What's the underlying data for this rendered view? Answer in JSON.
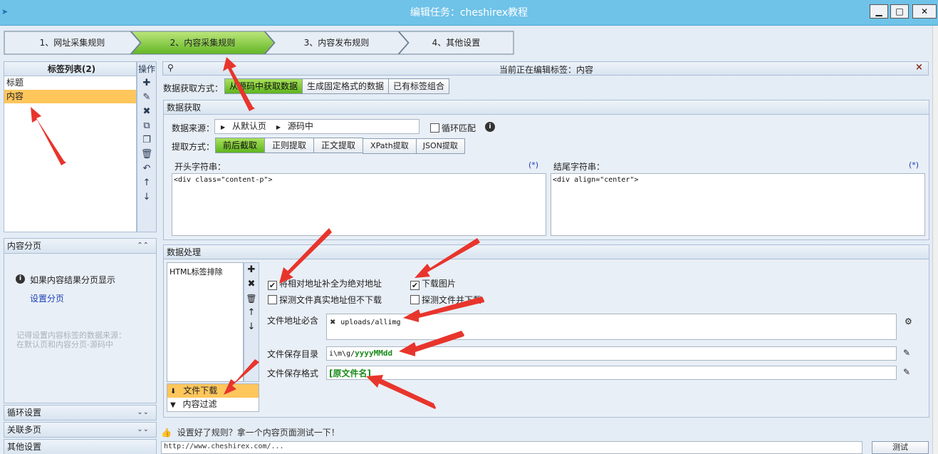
{
  "window": {
    "title": "编辑任务：cheshirex教程",
    "min": "▁",
    "max": "□",
    "close": "✕"
  },
  "steps": [
    "1、网址采集规则",
    "2、内容采集规则",
    "3、内容发布规则",
    "4、其他设置"
  ],
  "tag_list": {
    "title": "标签列表(2)",
    "items": [
      "标题",
      "内容"
    ],
    "ops_label": "操作"
  },
  "side": {
    "pagination_title": "内容分页",
    "pagination_info": "如果内容结果分页显示",
    "pagination_link": "设置分页",
    "note_line1": "记得设置内容标签的数据来源：",
    "note_line2": "在默认页和内容分页-源码中",
    "loop_title": "循环设置",
    "multi_title": "关联多页",
    "other_title": "其他设置"
  },
  "editing": {
    "label": "当前正在编辑标签：内容",
    "close": "×"
  },
  "acquire": {
    "label": "数据获取方式：",
    "options": [
      "从源码中获取数据",
      "生成固定格式的数据",
      "已有标签组合"
    ]
  },
  "fetch": {
    "title": "数据获取",
    "source_label": "数据来源：",
    "source_part1": "从默认页",
    "source_part2": "源码中",
    "loop_match": "循环匹配",
    "method_label": "提取方式：",
    "methods": [
      "前后截取",
      "正则提取",
      "正文提取",
      "XPath提取",
      "JSON提取"
    ],
    "start_label": "开头字符串：",
    "start_value": "<div class=\"content-p\">",
    "end_label": "结尾字符串：",
    "end_value": "<div align=\"center\">",
    "star": "(*)"
  },
  "process": {
    "title": "数据处理",
    "list": [
      "HTML标签排除"
    ],
    "bottom_items": [
      "文件下载",
      "内容过滤"
    ],
    "cb_abs": "将相对地址补全为绝对地址",
    "cb_probe_no": "探测文件真实地址但不下载",
    "cb_download_img": "下载图片",
    "cb_probe_dl": "探测文件并下载",
    "must_label": "文件地址必含",
    "must_value": "uploads/allimg",
    "dir_label": "文件保存目录",
    "dir_prefix": "i\\m\\g/",
    "dir_value": "yyyyMMdd",
    "fmt_label": "文件保存格式",
    "fmt_value": "[原文件名]"
  },
  "bottom": {
    "hint": "设置好了规则？拿一个内容页面测试一下！",
    "url_partial": "http://www.cheshirex.com/...",
    "test_button": "测试"
  },
  "colors": {
    "accent_green": "#5fb51f",
    "selected": "#ffc65c",
    "arrow_red": "#e8352c"
  }
}
